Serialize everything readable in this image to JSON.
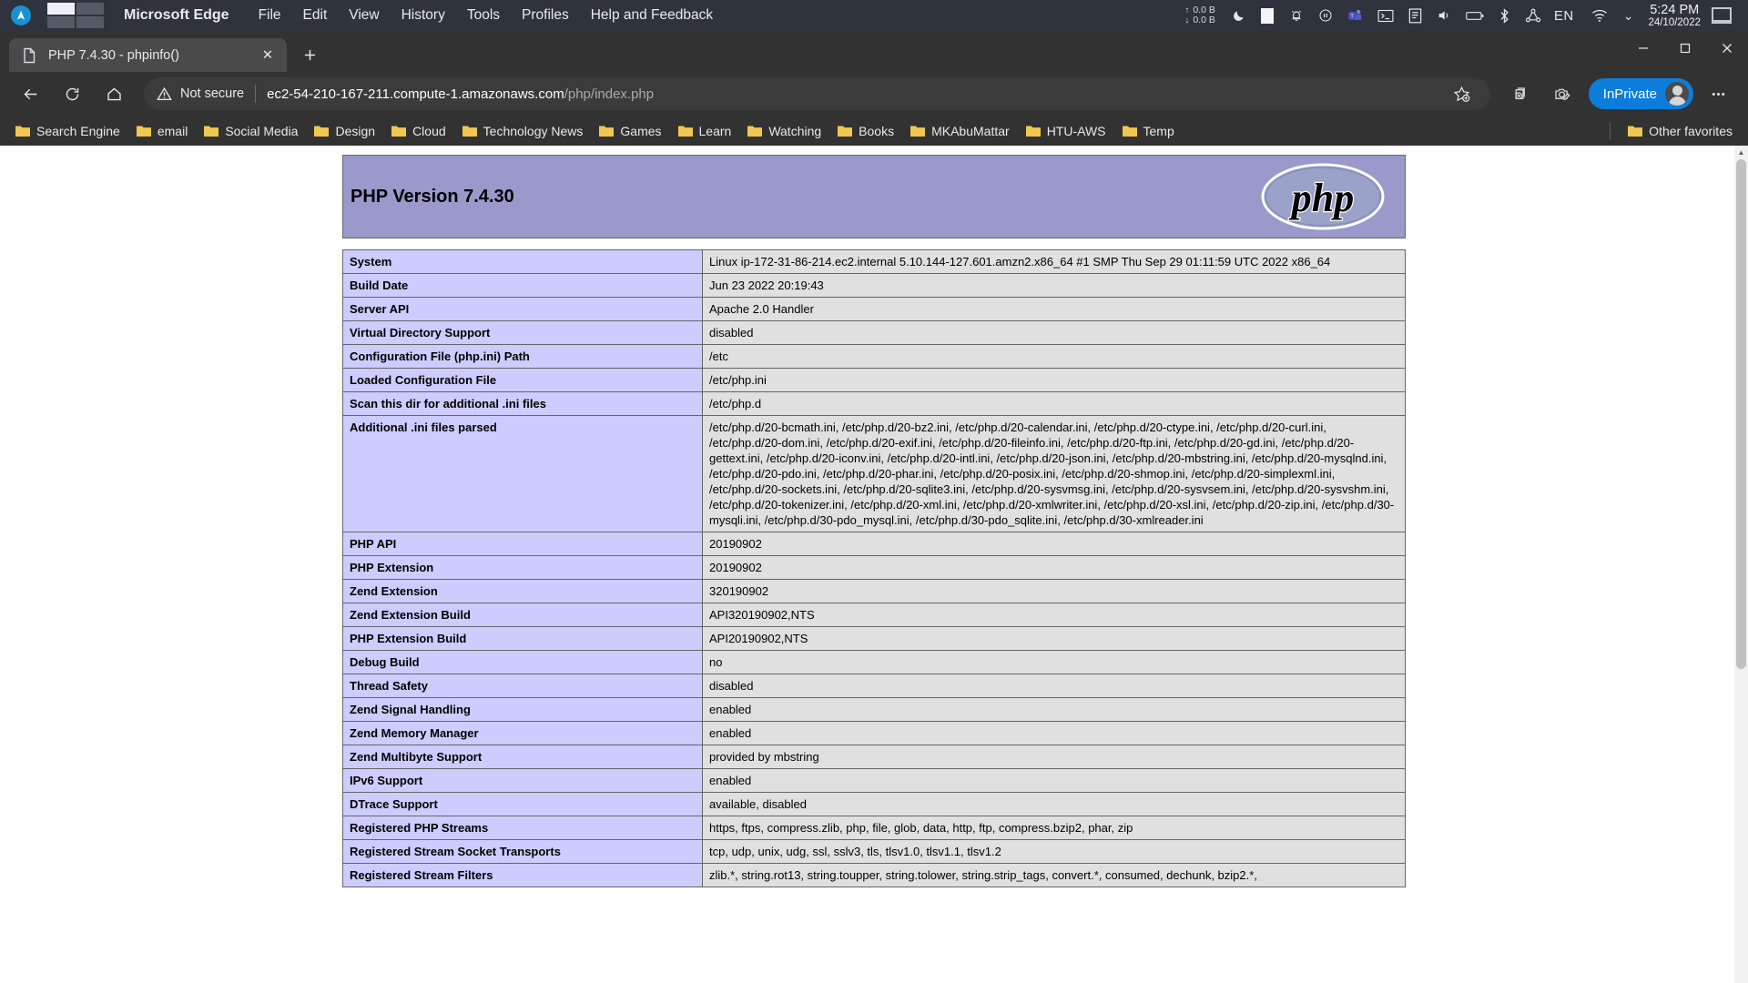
{
  "os_panel": {
    "logo": "arch-logo",
    "workspaces": [
      {
        "active": true
      },
      {
        "active": false
      },
      {
        "active": false
      },
      {
        "active": false
      }
    ],
    "app_title": "Microsoft Edge",
    "menus": [
      "File",
      "Edit",
      "View",
      "History",
      "Tools",
      "Profiles",
      "Help and Feedback"
    ],
    "network": {
      "up": "0.0 B",
      "down": "0.0 B",
      "up_arrow": "↑",
      "down_arrow": "↓"
    },
    "tray_icons": [
      "moon-icon",
      "clipboard-white-icon",
      "bell-notification-icon",
      "pause-circle-icon",
      "microsoft-teams-icon",
      "terminal-icon",
      "clipboard-icon",
      "volume-icon",
      "battery-icon",
      "bluetooth-icon",
      "network-connections-icon"
    ],
    "language": "EN",
    "wifi_icon": "wifi-icon",
    "chevron": "⌄",
    "clock_time": "5:24 PM",
    "clock_date": "24/10/2022"
  },
  "browser": {
    "tabs": [
      {
        "favicon": "page-icon",
        "title": "PHP 7.4.30 - phpinfo()",
        "close": "✕"
      }
    ],
    "new_tab_label": "+",
    "window_controls": {
      "minimize": "—",
      "maximize": "▢",
      "close": "✕"
    },
    "toolbar": {
      "back_icon": "back-arrow-icon",
      "reload_icon": "reload-icon",
      "home_icon": "home-icon",
      "security_text": "Not secure",
      "security_icon": "warning-triangle-icon",
      "url_host": "ec2-54-210-167-211.compute-1.amazonaws.com",
      "url_path": "/php/index.php",
      "favorite_icon": "star-add-icon",
      "collections_icon": "collections-add-icon",
      "browser_essentials_icon": "screenshot-edit-icon",
      "inprivate_label": "InPrivate",
      "avatar": "user-avatar",
      "settings_icon": "more-options-icon"
    },
    "bookmarks": [
      "Search Engine",
      "email",
      "Social Media",
      "Design",
      "Cloud",
      "Technology News",
      "Games",
      "Learn",
      "Watching",
      "Books",
      "MKAbuMattar",
      "HTU-AWS",
      "Temp"
    ],
    "other_favorites": "Other favorites"
  },
  "phpinfo": {
    "version_title": "PHP Version 7.4.30",
    "logo_text": "php",
    "rows": [
      {
        "key": "System",
        "value": "Linux ip-172-31-86-214.ec2.internal 5.10.144-127.601.amzn2.x86_64 #1 SMP Thu Sep 29 01:11:59 UTC 2022 x86_64"
      },
      {
        "key": "Build Date",
        "value": "Jun 23 2022 20:19:43"
      },
      {
        "key": "Server API",
        "value": "Apache 2.0 Handler"
      },
      {
        "key": "Virtual Directory Support",
        "value": "disabled"
      },
      {
        "key": "Configuration File (php.ini) Path",
        "value": "/etc"
      },
      {
        "key": "Loaded Configuration File",
        "value": "/etc/php.ini"
      },
      {
        "key": "Scan this dir for additional .ini files",
        "value": "/etc/php.d"
      },
      {
        "key": "Additional .ini files parsed",
        "value": "/etc/php.d/20-bcmath.ini, /etc/php.d/20-bz2.ini, /etc/php.d/20-calendar.ini, /etc/php.d/20-ctype.ini, /etc/php.d/20-curl.ini, /etc/php.d/20-dom.ini, /etc/php.d/20-exif.ini, /etc/php.d/20-fileinfo.ini, /etc/php.d/20-ftp.ini, /etc/php.d/20-gd.ini, /etc/php.d/20-gettext.ini, /etc/php.d/20-iconv.ini, /etc/php.d/20-intl.ini, /etc/php.d/20-json.ini, /etc/php.d/20-mbstring.ini, /etc/php.d/20-mysqlnd.ini, /etc/php.d/20-pdo.ini, /etc/php.d/20-phar.ini, /etc/php.d/20-posix.ini, /etc/php.d/20-shmop.ini, /etc/php.d/20-simplexml.ini, /etc/php.d/20-sockets.ini, /etc/php.d/20-sqlite3.ini, /etc/php.d/20-sysvmsg.ini, /etc/php.d/20-sysvsem.ini, /etc/php.d/20-sysvshm.ini, /etc/php.d/20-tokenizer.ini, /etc/php.d/20-xml.ini, /etc/php.d/20-xmlwriter.ini, /etc/php.d/20-xsl.ini, /etc/php.d/20-zip.ini, /etc/php.d/30-mysqli.ini, /etc/php.d/30-pdo_mysql.ini, /etc/php.d/30-pdo_sqlite.ini, /etc/php.d/30-xmlreader.ini"
      },
      {
        "key": "PHP API",
        "value": "20190902"
      },
      {
        "key": "PHP Extension",
        "value": "20190902"
      },
      {
        "key": "Zend Extension",
        "value": "320190902"
      },
      {
        "key": "Zend Extension Build",
        "value": "API320190902,NTS"
      },
      {
        "key": "PHP Extension Build",
        "value": "API20190902,NTS"
      },
      {
        "key": "Debug Build",
        "value": "no"
      },
      {
        "key": "Thread Safety",
        "value": "disabled"
      },
      {
        "key": "Zend Signal Handling",
        "value": "enabled"
      },
      {
        "key": "Zend Memory Manager",
        "value": "enabled"
      },
      {
        "key": "Zend Multibyte Support",
        "value": "provided by mbstring"
      },
      {
        "key": "IPv6 Support",
        "value": "enabled"
      },
      {
        "key": "DTrace Support",
        "value": "available, disabled"
      },
      {
        "key": "Registered PHP Streams",
        "value": "https, ftps, compress.zlib, php, file, glob, data, http, ftp, compress.bzip2, phar, zip"
      },
      {
        "key": "Registered Stream Socket Transports",
        "value": "tcp, udp, unix, udg, ssl, sslv3, tls, tlsv1.0, tlsv1.1, tlsv1.2"
      },
      {
        "key": "Registered Stream Filters",
        "value": "zlib.*, string.rot13, string.toupper, string.tolower, string.strip_tags, convert.*, consumed, dechunk, bzip2.*,"
      }
    ]
  },
  "colors": {
    "panel_bg": "#2e333d",
    "chrome_bg": "#323232",
    "accent_blue": "#0d7ddb",
    "php_header_bg": "#9999cc",
    "php_key_bg": "#ccccff",
    "php_value_bg": "#e0e0e0",
    "bookmark_folder": "#f0c850"
  }
}
